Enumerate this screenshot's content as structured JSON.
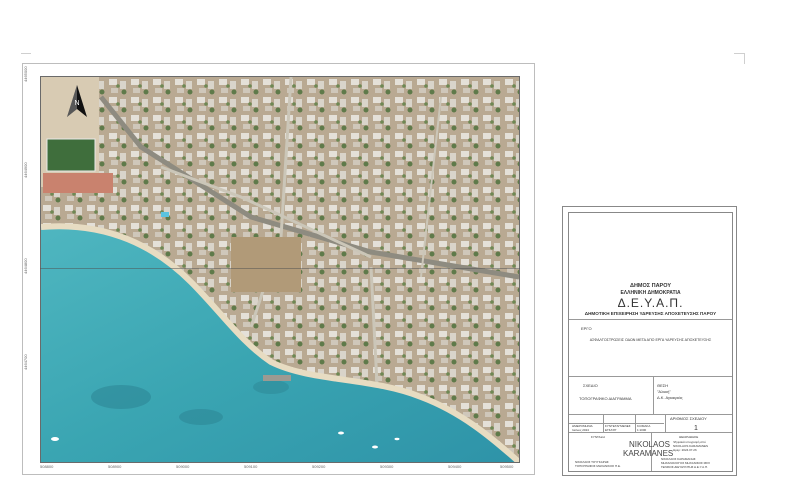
{
  "map": {
    "north_arrow_icon": "north-arrow-icon",
    "y_ticks": [
      "4465000",
      "4464900",
      "4464800",
      "4464700"
    ],
    "x_ticks": [
      "508800",
      "508900",
      "509000",
      "509100",
      "509200",
      "509300",
      "509400",
      "509500"
    ]
  },
  "titleblock": {
    "municipality": "ΔΗΜΟΣ ΠΑΡΟΥ",
    "republic": "ΕΛΛΗΝΙΚΗ ΔΗΜΟΚΡΑΤΙΑ",
    "agency_abbr": "Δ.Ε.Υ.Α.Π.",
    "agency_full": "ΔΗΜΟΤΙΚΗ ΕΠΙΧΕΙΡΗΣΗ ΥΔΡΕΥΣΗΣ ΑΠΟΧΕΤΕΥΣΗΣ ΠΑΡΟΥ",
    "project_label": "ΕΡΓΟ",
    "project_title": "ΑΣΦΑΛΤΟΣΤΡΩΣΕΙΣ ΟΔΩΝ ΜΕΤΑ ΑΠΟ ΕΡΓΑ ΥΔΡΕΥΣΗΣ ΑΠΟΧΕΤΕΥΣΗΣ",
    "drawing_label": "ΣΧΕΔΙΟ",
    "drawing_title": "ΤΟΠΟΓΡΑΦΙΚΟ ΔΙΑΓΡΑΜΜΑ",
    "location_label": "ΘΕΣΗ",
    "location_line1": "\"Αλυκή\"",
    "location_line2": "Δ.Κ. Αγκαιριάς",
    "date_label": "ΗΜΕΡΟΜΗΝΙΑ",
    "date_value": "Ιούλιος 2024",
    "coords_label": "ΣΥΝΤΕΤΑΓΜΕΝΕΣ",
    "coords_value": "ΕΓΣΑ'87",
    "scale_label": "ΚΛΙΜΑΚΑ",
    "scale_value": "1:1000",
    "drawing_no_label": "ΑΡΙΘΜΟΣ ΣΧΕΔΙΟΥ",
    "drawing_no": "1",
    "designed_label": "ΣΥΝΤΑΞΗ",
    "checked_label": "ΘΕΩΡΗΘΗΚΕ",
    "signatory_first": "NIKOLAOS",
    "signatory_last": "KARAMANES",
    "stamp_lines": [
      "Ψηφιακά υπογραφή από",
      "NIKOLAOS KARAMANES",
      "Ημερ: 2024.07.26"
    ],
    "designer_name": "ΝΙΚΟΛΑΟΣ ΤΟΥΓΚΑΡΗΣ",
    "designer_title": "ΤΟΠΟΓΡΑΦΟΣ ΜΗΧΑΝΙΚΟΣ Π.Ε.",
    "approver_name": "ΝΙΚΟΛΑΟΣ ΚΑΡΑΜΑΝΗΣ",
    "approver_title1": "ΜΗΧΑΝΟΛΟΓΟΣ ΜΗΧΑΝΙΚΟΣ ΜΣΧ",
    "approver_title2": "ΓΕΝΙΚΟΣ ΔΙΕΥΘΥΝΤΗΣ Δ.Ε.Υ.Α.Π."
  }
}
